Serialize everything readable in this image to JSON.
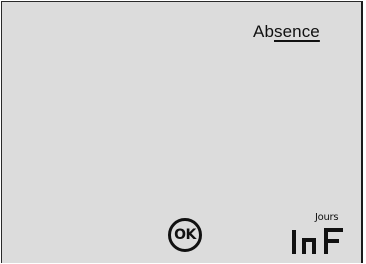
{
  "mode": {
    "title_part1": "Ab",
    "title_part2": "sence"
  },
  "confirm": {
    "label": "OK"
  },
  "duration": {
    "unit_label": "Jours",
    "value": "InF"
  }
}
